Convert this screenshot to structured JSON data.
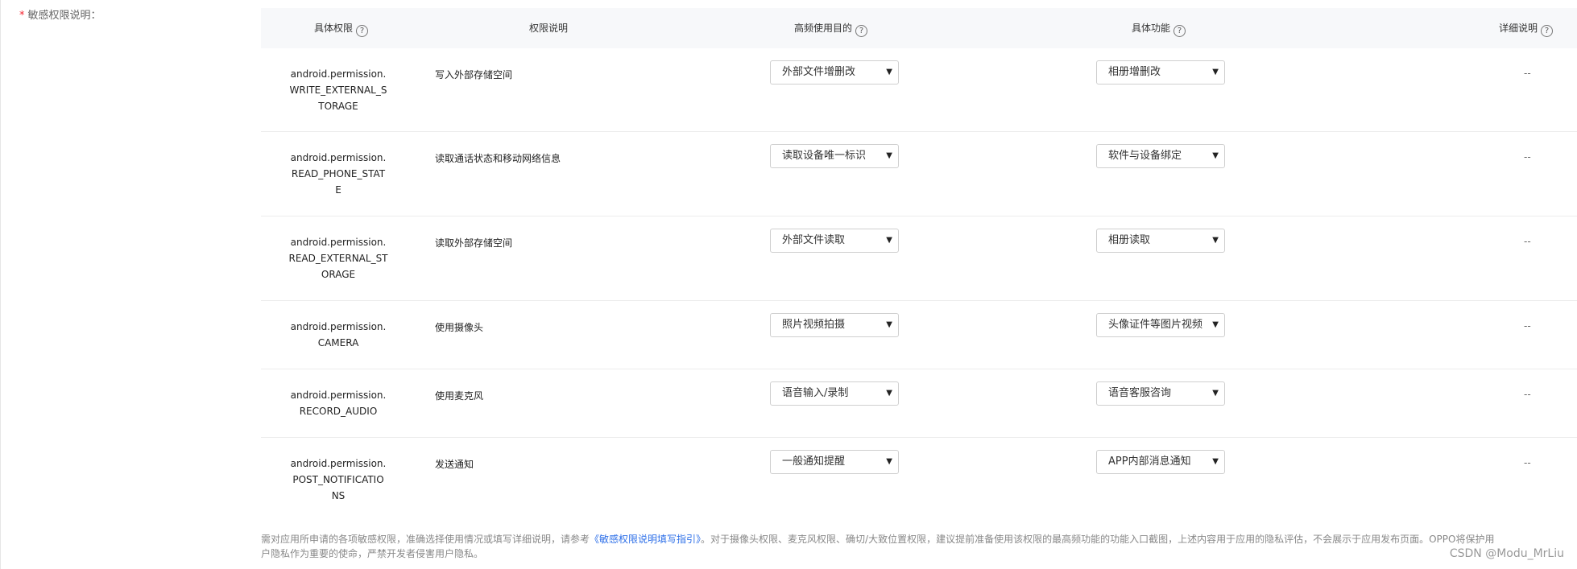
{
  "field_label": {
    "required_mark": "*",
    "text": "敏感权限说明："
  },
  "table": {
    "headers": {
      "permission": "具体权限",
      "description": "权限说明",
      "purpose": "高频使用目的",
      "function": "具体功能",
      "detail": "详细说明"
    },
    "help_glyph": "?",
    "rows": [
      {
        "permission_lines": [
          "android.permission.",
          "WRITE_EXTERNAL_S",
          "TORAGE"
        ],
        "description": "写入外部存储空间",
        "purpose": "外部文件增删改",
        "function": "相册增删改",
        "detail": "--"
      },
      {
        "permission_lines": [
          "android.permission.",
          "READ_PHONE_STAT",
          "E"
        ],
        "description": "读取通话状态和移动网络信息",
        "purpose": "读取设备唯一标识",
        "function": "软件与设备绑定",
        "detail": "--"
      },
      {
        "permission_lines": [
          "android.permission.",
          "READ_EXTERNAL_ST",
          "ORAGE"
        ],
        "description": "读取外部存储空间",
        "purpose": "外部文件读取",
        "function": "相册读取",
        "detail": "--"
      },
      {
        "permission_lines": [
          "android.permission.",
          "CAMERA"
        ],
        "description": "使用摄像头",
        "purpose": "照片视频拍摄",
        "function": "头像证件等图片视频",
        "detail": "--"
      },
      {
        "permission_lines": [
          "android.permission.",
          "RECORD_AUDIO"
        ],
        "description": "使用麦克风",
        "purpose": "语音输入/录制",
        "function": "语音客服咨询",
        "detail": "--"
      },
      {
        "permission_lines": [
          "android.permission.",
          "POST_NOTIFICATIO",
          "NS"
        ],
        "description": "发送通知",
        "purpose": "一般通知提醒",
        "function": "APP内部消息通知",
        "detail": "--"
      }
    ]
  },
  "footer": {
    "text_before_link": "需对应用所申请的各项敏感权限，准确选择使用情况或填写详细说明，请参考",
    "link_text": "《敏感权限说明填写指引》",
    "text_after_link": "。对于摄像头权限、麦克风权限、确切/大致位置权限，建议提前准备使用该权限的最高频功能的功能入口截图，上述内容用于应用的隐私评估，不会展示于应用发布页面。OPPO将保护用户隐私作为重要的使命，严禁开发者侵害用户隐私。"
  },
  "watermark": "CSDN @Modu_MrLiu"
}
